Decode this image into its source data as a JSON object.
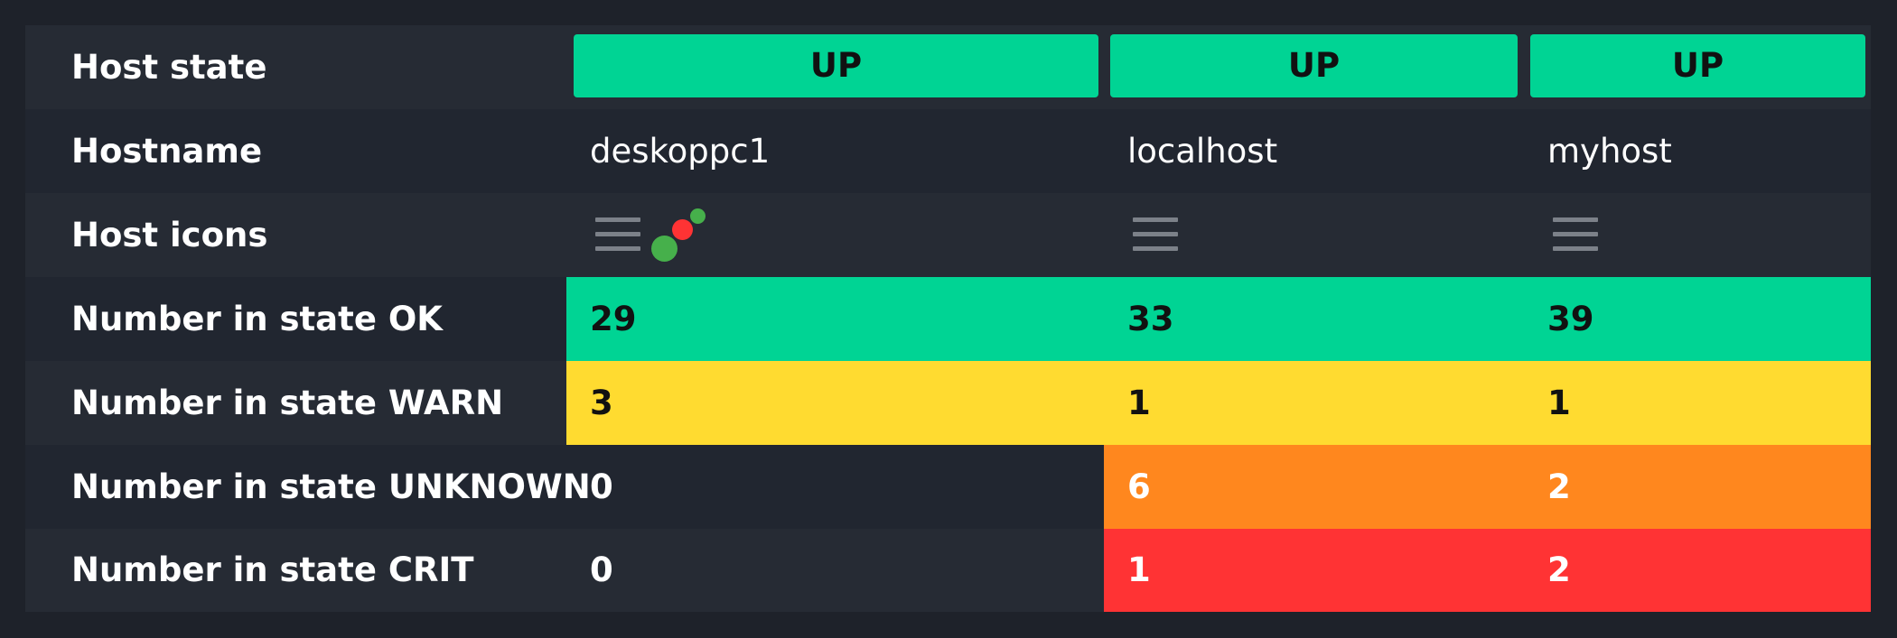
{
  "colors": {
    "background": "#1e222a",
    "row_odd": "#262b34",
    "row_even": "#212630",
    "up": "#00d494",
    "ok": "#00d494",
    "warn": "#ffdb30",
    "unknown": "#ff871e",
    "crit": "#ff3334",
    "icon_gray": "#7c8189",
    "dot_green": "#46b04b",
    "dot_red": "#ff3334"
  },
  "rows": {
    "host_state": {
      "label": "Host state"
    },
    "hostname": {
      "label": "Hostname"
    },
    "host_icons": {
      "label": "Host icons"
    },
    "ok": {
      "label": "Number in state OK"
    },
    "warn": {
      "label": "Number in state WARN"
    },
    "unknown": {
      "label": "Number in state UNKNOWN"
    },
    "crit": {
      "label": "Number in state CRIT"
    }
  },
  "hosts": [
    {
      "state": "UP",
      "hostname": "deskoppc1",
      "icons": [
        "menu-icon",
        "status-dots-icon"
      ],
      "ok": "29",
      "warn": "3",
      "unknown": "0",
      "crit": "0"
    },
    {
      "state": "UP",
      "hostname": "localhost",
      "icons": [
        "menu-icon"
      ],
      "ok": "33",
      "warn": "1",
      "unknown": "6",
      "crit": "1"
    },
    {
      "state": "UP",
      "hostname": "myhost",
      "icons": [
        "menu-icon"
      ],
      "ok": "39",
      "warn": "1",
      "unknown": "2",
      "crit": "2"
    }
  ]
}
